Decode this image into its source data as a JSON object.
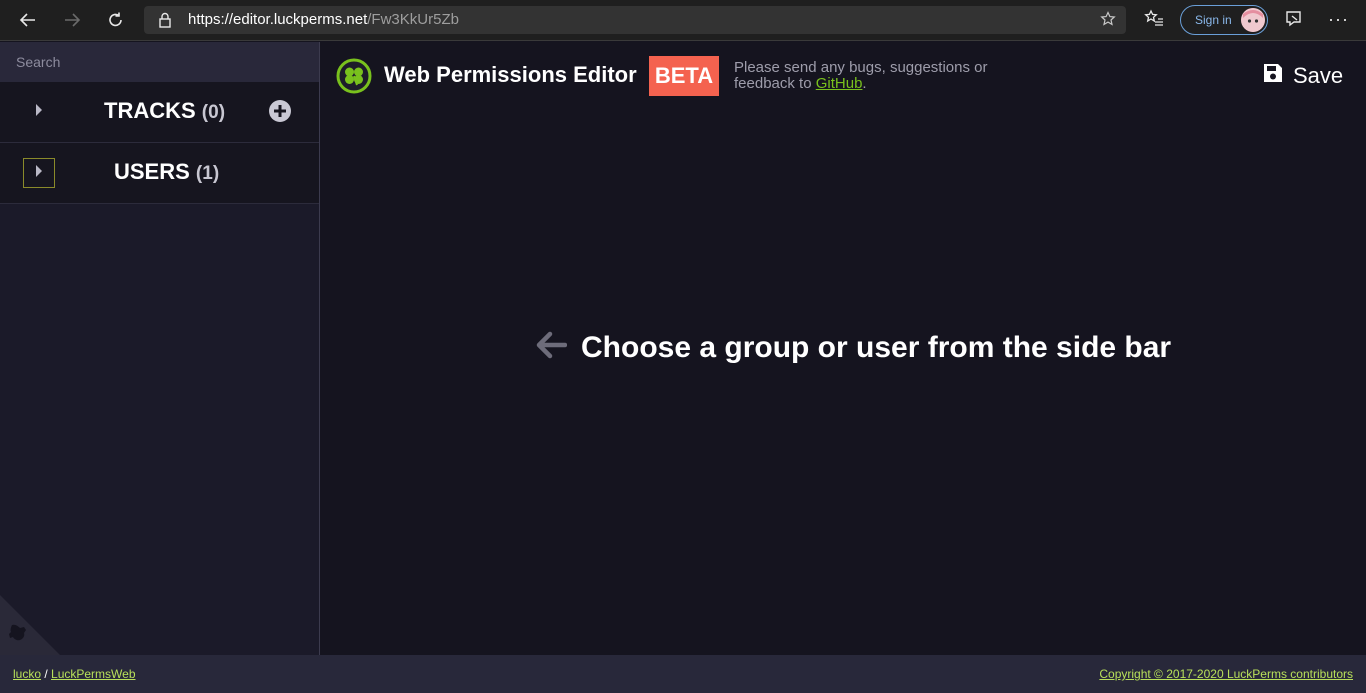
{
  "browser": {
    "url_host": "https://editor.luckperms.net",
    "url_path": "/Fw3KkUr5Zb",
    "sign_in_label": "Sign in",
    "more_label": "···"
  },
  "sidebar": {
    "search_placeholder": "Search",
    "sections": [
      {
        "title": "TRACKS",
        "count": "(0)"
      },
      {
        "title": "USERS",
        "count": "(1)"
      }
    ]
  },
  "header": {
    "title": "Web Permissions Editor",
    "badge": "BETA",
    "notice_text": "Please send any bugs, suggestions or feedback to ",
    "notice_link": "GitHub",
    "notice_end": ".",
    "save_label": "Save"
  },
  "main": {
    "empty_message": "Choose a group or user from the side bar"
  },
  "footer": {
    "author_link": "lucko",
    "separator": " / ",
    "repo_link": "LuckPermsWeb",
    "copyright": "Copyright © 2017-2020 LuckPerms contributors"
  },
  "colors": {
    "accent_green": "#79c11d",
    "beta_red": "#f4624f",
    "background": "#15141f",
    "sidebar": "#1b1a29"
  },
  "icons": [
    "back-arrow-icon",
    "forward-arrow-icon",
    "refresh-icon",
    "lock-icon",
    "star-icon",
    "favorites-icon",
    "extensions-icon",
    "chevron-right-icon",
    "plus-circle-icon",
    "clover-logo-icon",
    "save-icon",
    "left-arrow-icon"
  ]
}
